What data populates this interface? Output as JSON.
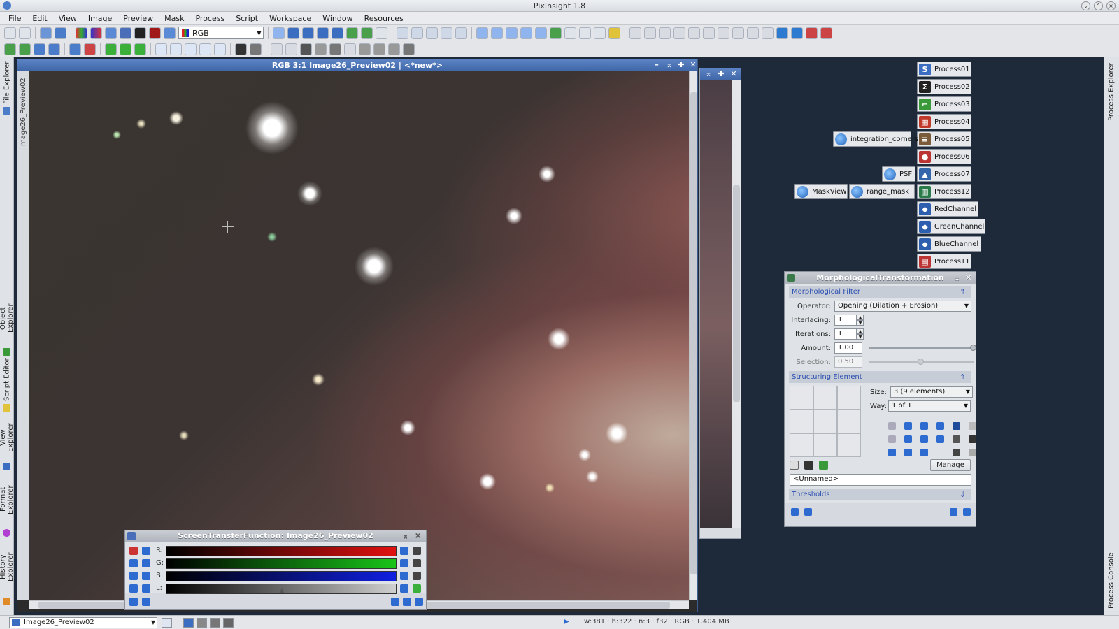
{
  "app": {
    "title": "PixInsight 1.8"
  },
  "menu": [
    "File",
    "Edit",
    "View",
    "Image",
    "Preview",
    "Mask",
    "Process",
    "Script",
    "Workspace",
    "Window",
    "Resources"
  ],
  "toolbar": {
    "color_mode": "RGB"
  },
  "left_dock": {
    "tabs": [
      "File Explorer",
      "Object Explorer",
      "Script Editor",
      "View Explorer",
      "Format Explorer",
      "History Explorer"
    ]
  },
  "right_dock": {
    "tabs": [
      "Process Explorer",
      "Process Console"
    ]
  },
  "image_window": {
    "title": "RGB 3:1 Image26_Preview02 | <*new*>",
    "side_label": "Image26_Preview02"
  },
  "process_icons": [
    {
      "label": "Process01",
      "color": "#3b6dc1",
      "glyph": "S",
      "icon": "s-curve-icon"
    },
    {
      "label": "Process02",
      "color": "#222",
      "glyph": "Σ",
      "icon": "sigma-icon"
    },
    {
      "label": "Process03",
      "color": "#3a9a3a",
      "glyph": "⌐",
      "icon": "crop-icon"
    },
    {
      "label": "Process04",
      "color": "#c0392b",
      "glyph": "▦",
      "icon": "color-balance-icon"
    },
    {
      "label": "Process05",
      "color": "#7a5b3a",
      "glyph": "≡",
      "icon": "histogram-icon"
    },
    {
      "label": "Process06",
      "color": "#b33",
      "glyph": "●",
      "icon": "color-icon"
    },
    {
      "label": "Process07",
      "color": "#3366aa",
      "glyph": "▲",
      "icon": "curve-icon"
    },
    {
      "label": "Process12",
      "color": "#2a7a4a",
      "glyph": "▥",
      "icon": "grid-icon"
    },
    {
      "label": "RedChannel",
      "color": "#2e5fae",
      "glyph": "◆",
      "icon": "channel-icon"
    },
    {
      "label": "GreenChannel",
      "color": "#2e5fae",
      "glyph": "◆",
      "icon": "channel-icon"
    },
    {
      "label": "BlueChannel",
      "color": "#2e5fae",
      "glyph": "◆",
      "icon": "channel-icon"
    },
    {
      "label": "Process11",
      "color": "#b33",
      "glyph": "▤",
      "icon": "pixelmath-icon"
    }
  ],
  "script_icons": [
    {
      "label": "integration_corners"
    },
    {
      "label": "PSF"
    },
    {
      "label": "MaskView"
    },
    {
      "label": "range_mask"
    }
  ],
  "morph": {
    "title": "MorphologicalTransformation",
    "filter_section": "Morphological Filter",
    "operator_label": "Operator:",
    "operator_value": "Opening (Dilation + Erosion)",
    "interlacing_label": "Interlacing:",
    "interlacing_value": "1",
    "iterations_label": "Iterations:",
    "iterations_value": "1",
    "amount_label": "Amount:",
    "amount_value": "1.00",
    "amount_fraction": 1.0,
    "selection_label": "Selection:",
    "selection_value": "0.50",
    "selection_fraction": 0.5,
    "structuring_section": "Structuring Element",
    "size_label": "Size:",
    "size_value": "3  (9 elements)",
    "way_label": "Way:",
    "way_value": "1 of 1",
    "manage_label": "Manage",
    "name_value": "<Unnamed>",
    "thresholds_section": "Thresholds"
  },
  "stf": {
    "title": "ScreenTransferFunction: Image26_Preview02",
    "channels": [
      {
        "label": "R:",
        "color": "#e01010"
      },
      {
        "label": "G:",
        "color": "#19c419"
      },
      {
        "label": "B:",
        "color": "#1020e0"
      },
      {
        "label": "L:",
        "color": "#cfcfcf"
      }
    ],
    "midtone_L": 0.5
  },
  "status": {
    "view": "Image26_Preview02",
    "info": "w:381 · h:322 · n:3 · f32 · RGB · 1.404 MB"
  }
}
